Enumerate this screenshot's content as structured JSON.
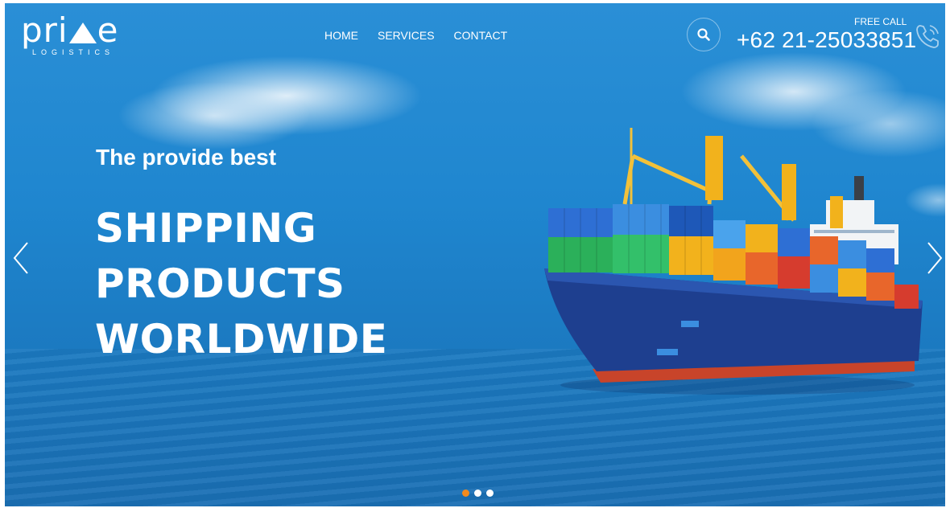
{
  "logo": {
    "word_left": "pri",
    "word_right": "e",
    "sub": "LOGISTICS"
  },
  "nav": {
    "items": [
      {
        "label": "HOME"
      },
      {
        "label": "SERVICES"
      },
      {
        "label": "CONTACT"
      }
    ]
  },
  "contact": {
    "free_call": "FREE CALL",
    "phone": "+62 21-25033851"
  },
  "hero": {
    "tagline": "The provide best",
    "headline": [
      "SHIPPING",
      "PRODUCTS",
      "WORLDWIDE"
    ]
  },
  "slider": {
    "slide_count": 3,
    "active_index": 0,
    "active_color": "#f28a1c"
  },
  "icons": {
    "search": "search-icon",
    "phone": "phone-icon",
    "prev": "chevron-left-icon",
    "next": "chevron-right-icon"
  },
  "colors": {
    "sky": "#2a8fd6",
    "sea": "#1a6fb4",
    "accent": "#f28a1c",
    "hull": "#1e3f8f",
    "hull_bottom": "#c8442a"
  }
}
